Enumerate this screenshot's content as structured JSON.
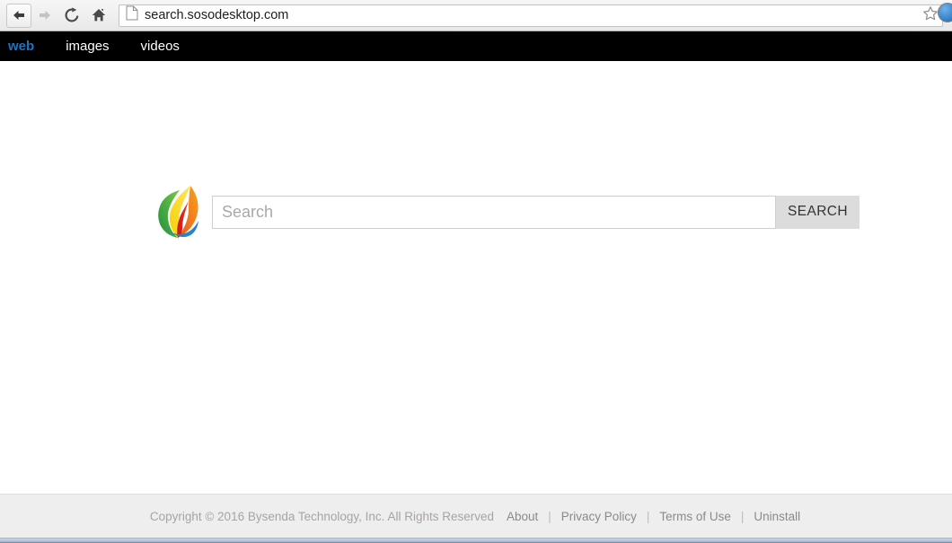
{
  "browser": {
    "back_icon": "arrow-left-icon",
    "forward_icon": "arrow-right-icon",
    "reload_icon": "reload-icon",
    "home_icon": "home-icon",
    "page_icon": "page-document-icon",
    "url": "search.sosodesktop.com",
    "bookmark_icon": "star-icon",
    "profile_icon": "profile-avatar-icon"
  },
  "site_nav": {
    "items": [
      {
        "label": "web",
        "active": true
      },
      {
        "label": "images",
        "active": false
      },
      {
        "label": "videos",
        "active": false
      }
    ]
  },
  "search": {
    "logo_name": "sosodesktop-leaf-logo",
    "placeholder": "Search",
    "value": "",
    "button_label": "SEARCH"
  },
  "footer": {
    "copyright": "Copyright © 2016 Bysenda Technology, Inc. All Rights Reserved",
    "separator": "|",
    "links": [
      {
        "label": "About"
      },
      {
        "label": "Privacy Policy"
      },
      {
        "label": "Terms of Use"
      },
      {
        "label": "Uninstall"
      }
    ]
  },
  "colors": {
    "nav_bar_bg": "#000000",
    "nav_active": "#1b74c4",
    "search_button_bg": "#dcdcdc",
    "footer_bg": "#eeeeee"
  }
}
